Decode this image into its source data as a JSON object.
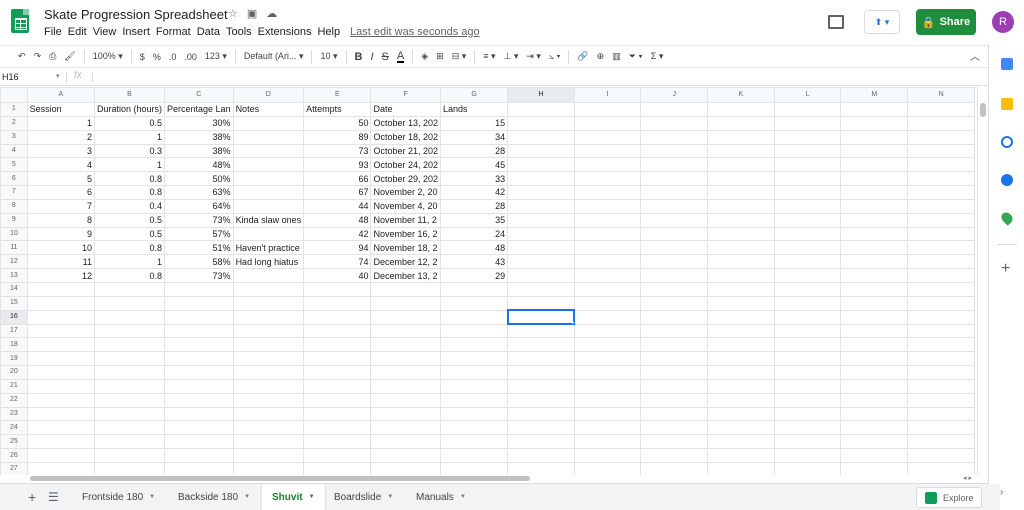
{
  "app": {
    "title": "Skate Progression Spreadsheet",
    "last_edit": "Last edit was seconds ago",
    "menu": [
      "File",
      "Edit",
      "View",
      "Insert",
      "Format",
      "Data",
      "Tools",
      "Extensions",
      "Help"
    ],
    "share_label": "Share",
    "avatar_letter": "R",
    "accent": "#1e8e3e"
  },
  "toolbar": {
    "zoom": "100%",
    "currency": "$",
    "percent": "%",
    "dec_decrease": ".0",
    "dec_increase": ".00",
    "format_more": "123",
    "font": "Default (Ari...",
    "font_size": "10",
    "sigma": "Σ"
  },
  "formula_bar": {
    "name_box": "H16",
    "fx": "fx",
    "value": ""
  },
  "columns": [
    "A",
    "B",
    "C",
    "D",
    "E",
    "F",
    "G",
    "H",
    "I",
    "J",
    "K",
    "L",
    "M",
    "N"
  ],
  "active_cell": {
    "col": "H",
    "row": 16
  },
  "header_row": [
    "Session",
    "Duration (hours)",
    "Percentage Lan",
    "Notes",
    "Attempts",
    "Date",
    "Lands"
  ],
  "rows": [
    [
      "1",
      "0.5",
      "30%",
      "",
      "50",
      "October 13, 202",
      "15"
    ],
    [
      "2",
      "1",
      "38%",
      "",
      "89",
      "October 18, 202",
      "34"
    ],
    [
      "3",
      "0.3",
      "38%",
      "",
      "73",
      "October 21, 202",
      "28"
    ],
    [
      "4",
      "1",
      "48%",
      "",
      "93",
      "October 24, 202",
      "45"
    ],
    [
      "5",
      "0.8",
      "50%",
      "",
      "66",
      "October 29, 202",
      "33"
    ],
    [
      "6",
      "0.8",
      "63%",
      "",
      "67",
      "November 2, 20",
      "42"
    ],
    [
      "7",
      "0.4",
      "64%",
      "",
      "44",
      "November 4, 20",
      "28"
    ],
    [
      "8",
      "0.5",
      "73%",
      "Kinda slaw ones",
      "48",
      "November 11, 2",
      "35"
    ],
    [
      "9",
      "0.5",
      "57%",
      "",
      "42",
      "November 16, 2",
      "24"
    ],
    [
      "10",
      "0.8",
      "51%",
      "Haven't practice",
      "94",
      "November 18, 2",
      "48"
    ],
    [
      "11",
      "1",
      "58%",
      "Had long hiatus",
      "74",
      "December 12, 2",
      "43"
    ],
    [
      "12",
      "0.8",
      "73%",
      "",
      "40",
      "December 13, 2",
      "29"
    ]
  ],
  "total_rows": 27,
  "sheet_tabs": [
    {
      "label": "Frontside 180",
      "active": false
    },
    {
      "label": "Backside 180",
      "active": false
    },
    {
      "label": "Shuvit",
      "active": true
    },
    {
      "label": "Boardslide",
      "active": false
    },
    {
      "label": "Manuals",
      "active": false
    }
  ],
  "explore_label": "Explore",
  "icons": {
    "star": "star-icon",
    "move": "folder-move-icon",
    "cloud": "cloud-saved-icon",
    "comments": "comment-icon",
    "present": "present-icon",
    "lock": "lock-icon"
  }
}
